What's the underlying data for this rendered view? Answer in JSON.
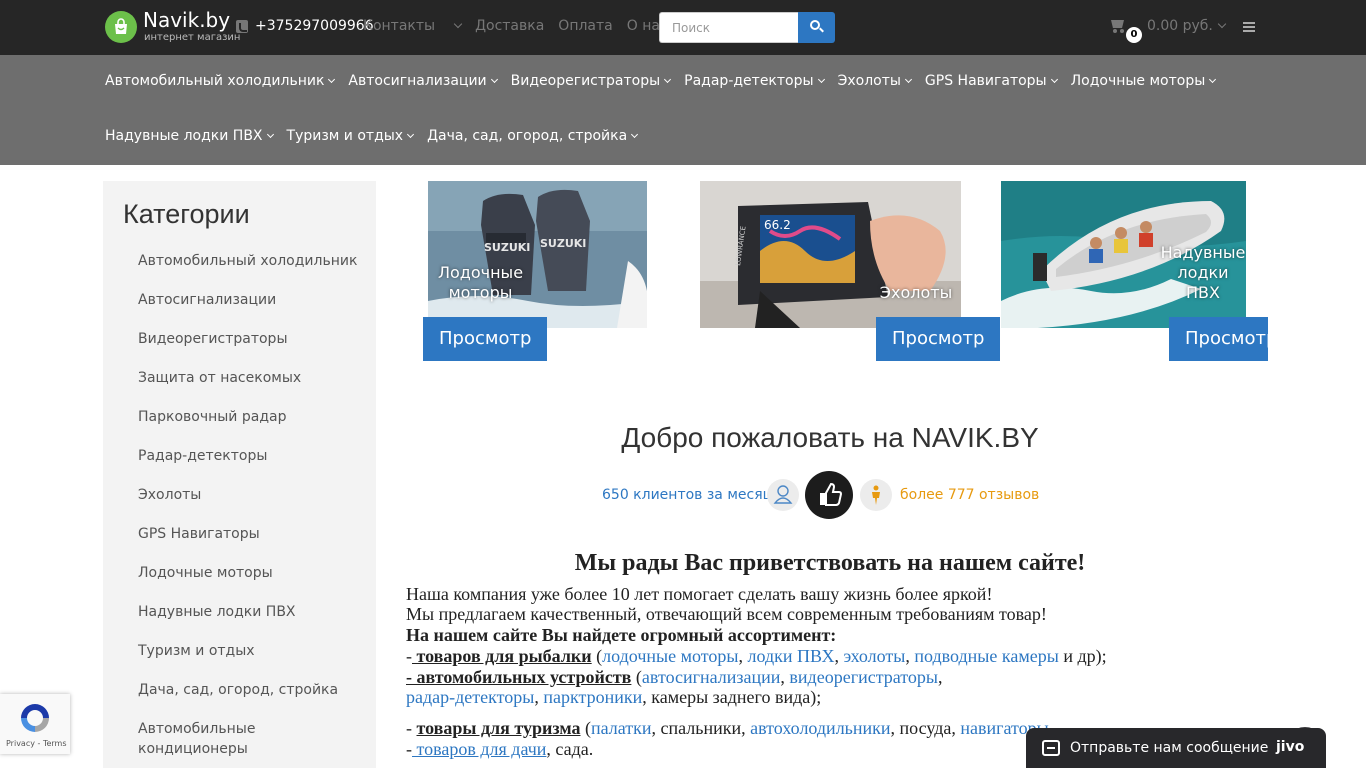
{
  "topbar": {
    "logo_name": "Navik.by",
    "logo_sub": "интернет магазин",
    "phone": "+375297009966",
    "nav": [
      "Контакты",
      "Доставка",
      "Оплата",
      "О нас"
    ],
    "search_placeholder": "Поиск",
    "cart_count": "0",
    "cart_total": "0.00 руб."
  },
  "menu": {
    "row1": [
      "Автомобильный холодильник",
      "Автосигнализации",
      "Видеорегистраторы",
      "Радар-детекторы",
      "Эхолоты",
      "GPS Навигаторы",
      "Лодочные моторы"
    ],
    "row2": [
      "Надувные лодки ПВХ",
      "Туризм и отдых",
      "Дача, сад, огород, стройка"
    ]
  },
  "sidebar": {
    "title": "Категории",
    "items": [
      "Автомобильный холодильник",
      "Автосигнализации",
      "Видеорегистраторы",
      "Защита от насекомых",
      "Парковочный радар",
      "Радар-детекторы",
      "Эхолоты",
      "GPS Навигаторы",
      "Лодочные моторы",
      "Надувные лодки ПВХ",
      "Туризм и отдых",
      "Дача, сад, огород, стройка",
      "Автомобильные кондиционеры"
    ]
  },
  "tiles": [
    {
      "label_line1": "Лодочные",
      "label_line2": "моторы",
      "button": "Просмотр",
      "brand": "SUZUKI"
    },
    {
      "label_line1": "Эхолоты",
      "button": "Просмотр",
      "brand": "LOWRANCE",
      "screen_value": "66.2"
    },
    {
      "label_line1": "Надувные",
      "label_line2": "лодки",
      "label_line3": "ПВХ",
      "button": "Просмотр"
    }
  ],
  "welcome": {
    "title": "Добро пожаловать на NAVIK.BY",
    "clients": "650 клиентов за месяц",
    "reviews": "более 777 отзывов"
  },
  "article": {
    "heading": "Мы рады Вас приветствовать на нашем сайте!",
    "p1": "Наша компания уже более 10 лет помогает сделать вашу жизнь более яркой!",
    "p2": "Мы предлагаем качественный, отвечающий всем современным требованиям товар!",
    "p3": "На нашем сайте Вы найдете огромный ассортимент:",
    "fishing_label": " товаров для рыбалки",
    "fishing_links": [
      "лодочные моторы",
      "лодки ПВХ",
      "эхолоты",
      "подводные камеры"
    ],
    "fishing_tail": " и др);",
    "auto_label": "- автомобильных устройств",
    "auto_links": [
      "автосигнализации",
      "видеорегистраторы",
      "радар-детекторы",
      "парктроники"
    ],
    "auto_tail": ", камеры заднего вида);",
    "tourism_label": "товары для туризма",
    "tourism_link1": "палатки",
    "tourism_mid1": ", спальники, ",
    "tourism_link2": "автохолодильники",
    "tourism_mid2": ", посуда, ",
    "tourism_link3": "навигаторы",
    "garden_label": " товаров для дачи",
    "garden_tail": ", сада."
  },
  "recaptcha": {
    "text": "Privacy - Terms"
  },
  "jivo": {
    "text": "Отправьте нам сообщение",
    "brand": "jivo"
  },
  "colors": {
    "topbar": "#262626",
    "menu": "#6e6e6e",
    "accent": "#2d77c2",
    "orange": "#e79a10",
    "green": "#6cc04a"
  }
}
